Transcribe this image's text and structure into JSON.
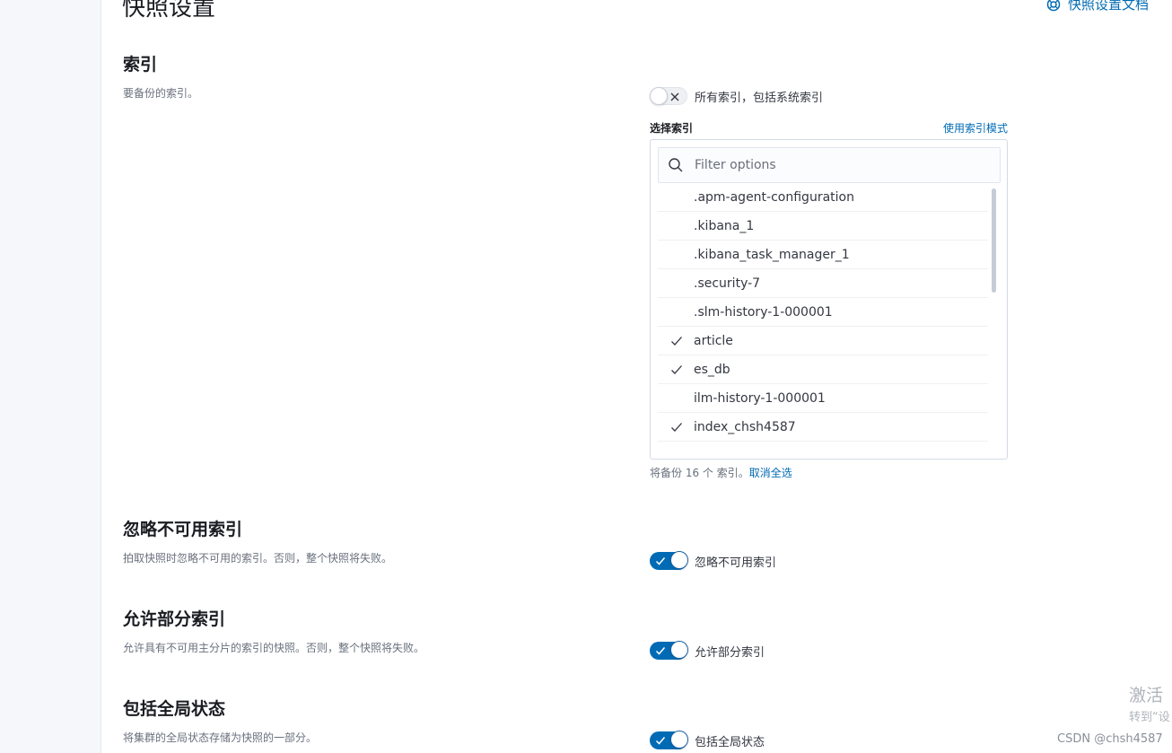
{
  "page": {
    "title": "快照设置",
    "doc_link": "快照设置文档"
  },
  "indices_section": {
    "title": "索引",
    "description": "要备份的索引。",
    "all_indices_toggle": {
      "label": "所有索引，包括系统索引",
      "checked": false
    },
    "select_label": "选择索引",
    "pattern_link": "使用索引模式",
    "search": {
      "placeholder": "Filter options",
      "value": ""
    },
    "options": [
      {
        "label": ".apm-agent-configuration",
        "checked": false
      },
      {
        "label": ".kibana_1",
        "checked": false
      },
      {
        "label": ".kibana_task_manager_1",
        "checked": false
      },
      {
        "label": ".security-7",
        "checked": false
      },
      {
        "label": ".slm-history-1-000001",
        "checked": false
      },
      {
        "label": "article",
        "checked": true
      },
      {
        "label": "es_db",
        "checked": true
      },
      {
        "label": "ilm-history-1-000001",
        "checked": false
      },
      {
        "label": "index_chsh4587",
        "checked": true
      }
    ],
    "summary_text": "将备份 16 个 索引。",
    "deselect_all": "取消全选"
  },
  "ignore_unavailable": {
    "title": "忽略不可用索引",
    "description": "拍取快照时忽略不可用的索引。否则，整个快照将失败。",
    "toggle_label": "忽略不可用索引",
    "checked": true
  },
  "partial": {
    "title": "允许部分索引",
    "description": "允许具有不可用主分片的索引的快照。否则，整个快照将失败。",
    "toggle_label": "允许部分索引",
    "checked": true
  },
  "global_state": {
    "title": "包括全局状态",
    "description": "将集群的全局状态存储为快照的一部分。",
    "toggle_label": "包括全局状态",
    "checked": true
  },
  "overlay": {
    "watermark_line1": "激活",
    "watermark_line2": "转到“设",
    "credit": "CSDN @chsh4587"
  },
  "colors": {
    "link": "#006bb4",
    "switch_on": "#006bb4",
    "text": "#343741",
    "muted": "#69707d"
  },
  "icons": {
    "doc_link": "help-circle-icon",
    "search": "search-icon",
    "option_selected": "check-icon",
    "switch_off": "cross-icon",
    "switch_on": "check-icon"
  }
}
